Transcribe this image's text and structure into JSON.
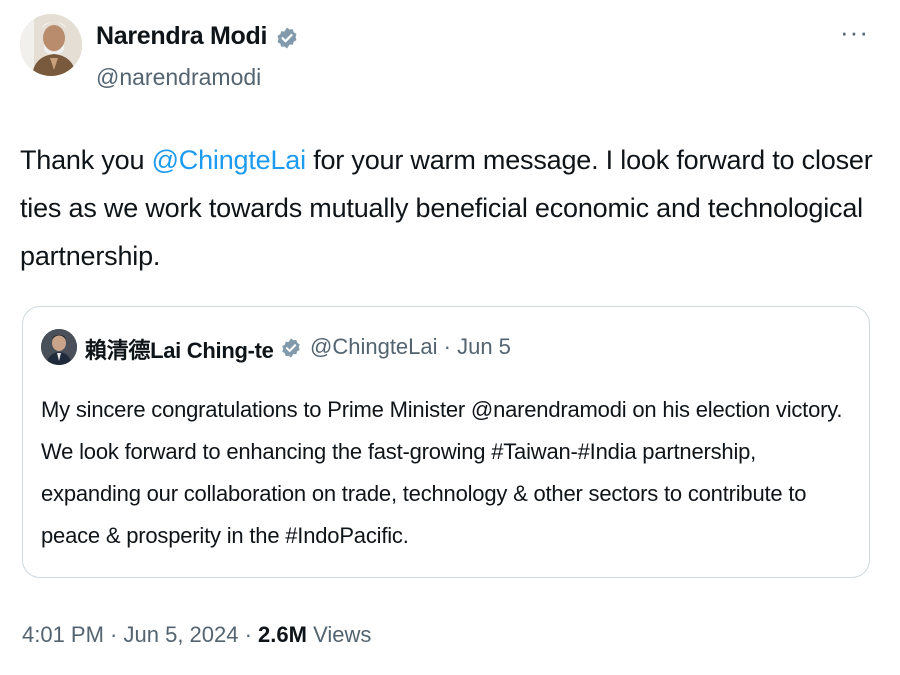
{
  "author": {
    "name": "Narendra Modi",
    "handle": "@narendramodi"
  },
  "tweet": {
    "text_before": "Thank you ",
    "mention": "@ChingteLai",
    "text_after": " for your warm message. I look forward to closer ties as we work towards mutually beneficial economic and technological partnership."
  },
  "quote": {
    "author_name": "賴清德Lai Ching-te",
    "handle": "@ChingteLai",
    "separator": " · ",
    "date": "Jun 5",
    "text": "My sincere congratulations to Prime Minister @narendramodi on his election victory. We look forward to enhancing the fast-growing #Taiwan-#India partnership, expanding our collaboration on trade, technology & other sectors to contribute to peace & prosperity in the #IndoPacific."
  },
  "footer": {
    "time": "4:01 PM",
    "sep1": " · ",
    "date": "Jun 5, 2024",
    "sep2": " · ",
    "views_count": "2.6M",
    "views_label": " Views"
  },
  "icons": {
    "verified": "verified-badge-icon",
    "more": "more-options-icon"
  },
  "colors": {
    "link": "#1d9bf0",
    "secondary_text": "#536471",
    "primary_text": "#0f1419",
    "verified_badge": "#829aab",
    "border": "#cfd9de"
  },
  "more_label": "···"
}
